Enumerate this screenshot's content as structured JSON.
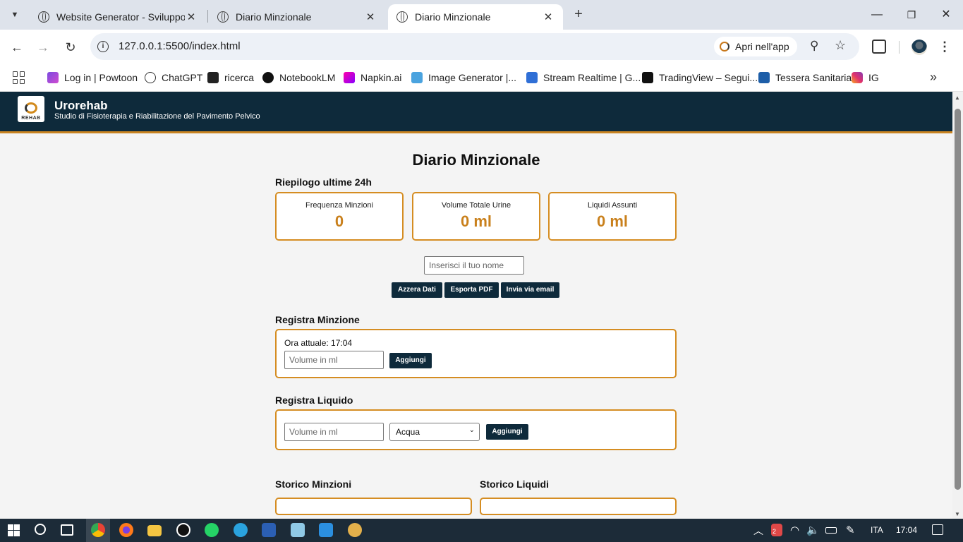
{
  "browser": {
    "tabs": [
      {
        "title": "Website Generator - Sviluppo P"
      },
      {
        "title": "Diario Minzionale"
      },
      {
        "title": "Diario Minzionale"
      }
    ],
    "url": "127.0.0.1:5500/index.html",
    "open_in_app": "Apri nell'app",
    "bookmarks": [
      {
        "label": "Log in | Powtoon"
      },
      {
        "label": "ChatGPT"
      },
      {
        "label": "ricerca"
      },
      {
        "label": "NotebookLM"
      },
      {
        "label": "Napkin.ai"
      },
      {
        "label": "Image Generator |..."
      },
      {
        "label": "Stream Realtime | G..."
      },
      {
        "label": "TradingView – Segui..."
      },
      {
        "label": "Tessera Sanitaria"
      },
      {
        "label": "IG"
      }
    ]
  },
  "site": {
    "brand": "Urorehab",
    "subtitle": "Studio di Fisioterapia e Riabilitazione del Pavimento Pelvico",
    "logo_text": "REHAB"
  },
  "page": {
    "title": "Diario Minzionale",
    "summary_heading": "Riepilogo ultime 24h",
    "cards": [
      {
        "label": "Frequenza Minzioni",
        "value": "0"
      },
      {
        "label": "Volume Totale Urine",
        "value": "0 ml"
      },
      {
        "label": "Liquidi Assunti",
        "value": "0 ml"
      }
    ],
    "name_placeholder": "Inserisci il tuo nome",
    "actions": {
      "reset": "Azzera Dati",
      "pdf": "Esporta PDF",
      "email": "Invia via email"
    },
    "minzione": {
      "heading": "Registra Minzione",
      "current_time": "Ora attuale: 17:04",
      "volume_placeholder": "Volume in ml",
      "add": "Aggiungi"
    },
    "liquido": {
      "heading": "Registra Liquido",
      "volume_placeholder": "Volume in ml",
      "type_selected": "Acqua",
      "add": "Aggiungi"
    },
    "history": {
      "minzioni": "Storico Minzioni",
      "liquidi": "Storico Liquidi"
    }
  },
  "taskbar": {
    "language": "ITA",
    "time": "17:04",
    "notification_count": "2"
  },
  "colors": {
    "header_bg": "#0e2a3b",
    "accent": "#d58d22",
    "value_text": "#c9801c"
  }
}
